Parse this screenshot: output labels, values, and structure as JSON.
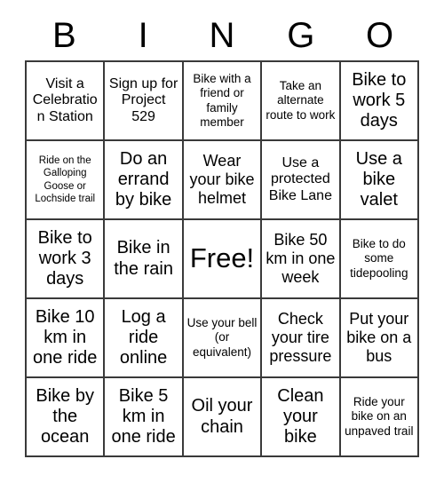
{
  "card": {
    "title": "BINGO",
    "columns": [
      "B",
      "I",
      "N",
      "G",
      "O"
    ],
    "grid_size": 5,
    "free_space_index": 12,
    "colors": {
      "background": "#ffffff",
      "text": "#000000",
      "border": "#3a3a3a"
    }
  },
  "cells": [
    {
      "text": "Visit a Celebration Station",
      "size": "m",
      "row": 1,
      "col": "B"
    },
    {
      "text": "Sign up for Project 529",
      "size": "m",
      "row": 1,
      "col": "I"
    },
    {
      "text": "Bike with a friend or family member",
      "size": "s",
      "row": 1,
      "col": "N"
    },
    {
      "text": "Take an alternate route to work",
      "size": "s",
      "row": 1,
      "col": "G"
    },
    {
      "text": "Bike to work 5 days",
      "size": "xl",
      "row": 1,
      "col": "O"
    },
    {
      "text": "Ride on the Galloping Goose or Lochside trail",
      "size": "xs",
      "row": 2,
      "col": "B"
    },
    {
      "text": "Do an errand by bike",
      "size": "xl",
      "row": 2,
      "col": "I"
    },
    {
      "text": "Wear your bike helmet",
      "size": "l",
      "row": 2,
      "col": "N"
    },
    {
      "text": "Use a protected Bike Lane",
      "size": "m",
      "row": 2,
      "col": "G"
    },
    {
      "text": "Use a bike valet",
      "size": "xl",
      "row": 2,
      "col": "O"
    },
    {
      "text": "Bike to work 3 days",
      "size": "xl",
      "row": 3,
      "col": "B"
    },
    {
      "text": "Bike in the rain",
      "size": "xl",
      "row": 3,
      "col": "I"
    },
    {
      "text": "Free!",
      "size": "xxl",
      "row": 3,
      "col": "N"
    },
    {
      "text": "Bike 50 km in one week",
      "size": "l",
      "row": 3,
      "col": "G"
    },
    {
      "text": "Bike to do some tidepooling",
      "size": "s",
      "row": 3,
      "col": "O"
    },
    {
      "text": "Bike 10 km in one ride",
      "size": "xl",
      "row": 4,
      "col": "B"
    },
    {
      "text": "Log a ride online",
      "size": "xl",
      "row": 4,
      "col": "I"
    },
    {
      "text": "Use your bell (or equivalent)",
      "size": "s",
      "row": 4,
      "col": "N"
    },
    {
      "text": "Check your tire pressure",
      "size": "l",
      "row": 4,
      "col": "G"
    },
    {
      "text": "Put your bike on a bus",
      "size": "l",
      "row": 4,
      "col": "O"
    },
    {
      "text": "Bike by the ocean",
      "size": "xl",
      "row": 5,
      "col": "B"
    },
    {
      "text": "Bike 5 km in one ride",
      "size": "xl",
      "row": 5,
      "col": "I"
    },
    {
      "text": "Oil your chain",
      "size": "xl",
      "row": 5,
      "col": "N"
    },
    {
      "text": "Clean your bike",
      "size": "xl",
      "row": 5,
      "col": "G"
    },
    {
      "text": "Ride your bike on an unpaved trail",
      "size": "s",
      "row": 5,
      "col": "O"
    }
  ]
}
